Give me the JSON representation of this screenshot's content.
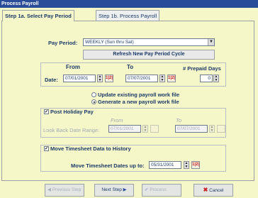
{
  "window": {
    "title": "Process Payroll"
  },
  "tabs": [
    {
      "label": "Step 1a. Select Pay Period"
    },
    {
      "label": "Step 1b. Process Payroll"
    }
  ],
  "pay_period": {
    "label": "Pay Period:",
    "selected": "WEEKLY (Sun thru Sat)",
    "refresh_label": "Refresh New Pay Period Cycle"
  },
  "dates": {
    "from_label": "From",
    "to_label": "To",
    "date_label": "Date:",
    "from_value": "07/01/2001",
    "to_value": "07/07/2001",
    "calendar_glyph": "1|2|",
    "prepaid_label": "# Prepaid Days",
    "prepaid_value": "0"
  },
  "payroll_file": {
    "option_update": "Update existing payroll work file",
    "option_generate": "Generate a new payroll work file",
    "selected": "generate"
  },
  "holiday": {
    "checkbox_label": "Post Holiday Pay",
    "checked": true,
    "from_label": "From",
    "to_label": "To",
    "range_label": "Look Back Date Range:",
    "from_value": "07/01/2001",
    "to_value": "07/07/2001"
  },
  "timesheet": {
    "checkbox_label": "Move Timesheet Data to History",
    "checked": true,
    "move_label": "Move Timesheet Dates up to:",
    "move_value": "05/31/2001"
  },
  "footer": {
    "previous_label": "Previous Step",
    "next_label": "Next Step",
    "process_label": "Process",
    "cancel_label": "Cancel"
  },
  "colors": {
    "titlebar": "#2a4d9a",
    "panel_bg": "#f6f7c8",
    "label_text": "#1a3a6a",
    "cancel_x": "#cc2222",
    "next_arrow": "#2a4d9a"
  }
}
